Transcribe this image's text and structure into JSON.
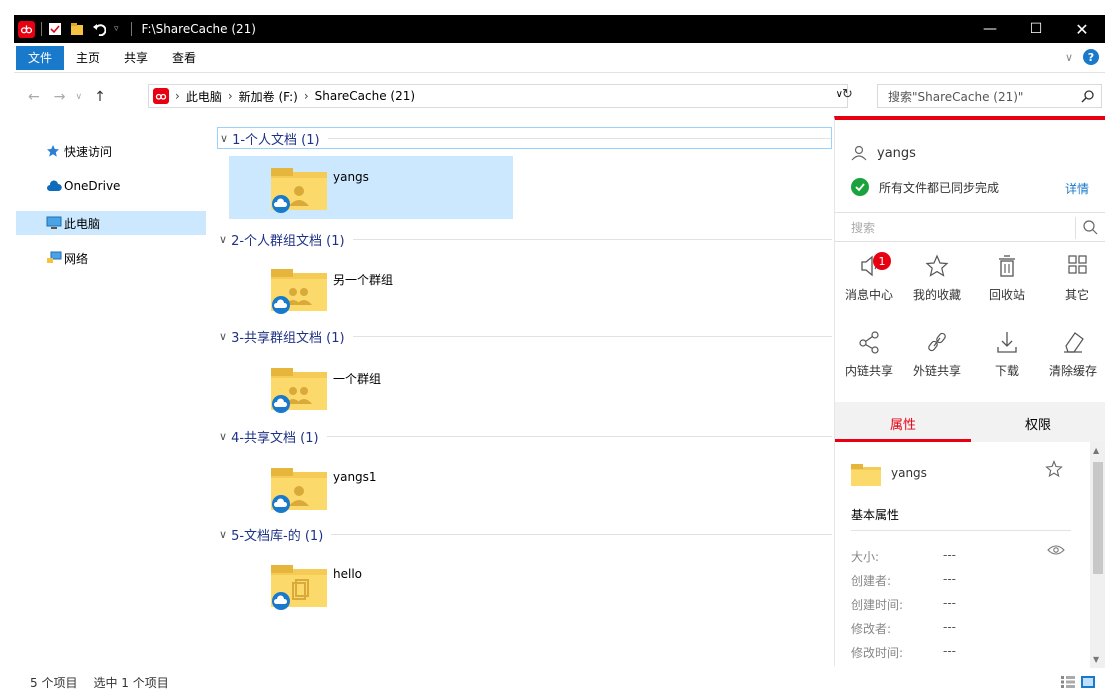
{
  "window": {
    "title": "F:\\ShareCache (21)"
  },
  "ribbon": {
    "tabs": [
      "文件",
      "主页",
      "共享",
      "查看"
    ]
  },
  "address": {
    "crumbs": [
      "此电脑",
      "新加卷 (F:)",
      "ShareCache (21)"
    ],
    "search_placeholder": "搜索\"ShareCache (21)\""
  },
  "nav": {
    "items": [
      {
        "label": "快速访问",
        "icon": "star-icon"
      },
      {
        "label": "OneDrive",
        "icon": "cloud-icon"
      },
      {
        "label": "此电脑",
        "icon": "computer-icon",
        "selected": true
      },
      {
        "label": "网络",
        "icon": "network-icon"
      }
    ]
  },
  "groups": [
    {
      "header": "1-个人文档 (1)",
      "item": "yangs",
      "icon": "person-folder-icon",
      "selected": true
    },
    {
      "header": "2-个人群组文档 (1)",
      "item": "另一个群组",
      "icon": "group-folder-icon"
    },
    {
      "header": "3-共享群组文档 (1)",
      "item": "一个群组",
      "icon": "group-folder-icon"
    },
    {
      "header": "4-共享文档 (1)",
      "item": "yangs1",
      "icon": "person-folder-icon"
    },
    {
      "header": "5-文档库-的 (1)",
      "item": "hello",
      "icon": "library-folder-icon"
    }
  ],
  "panel": {
    "user": "yangs",
    "sync_status": "所有文件都已同步完成",
    "detail_link": "详情",
    "search_placeholder": "搜索",
    "tools_row1": [
      {
        "label": "消息中心",
        "icon": "speaker-icon",
        "badge": "1"
      },
      {
        "label": "我的收藏",
        "icon": "star-icon"
      },
      {
        "label": "回收站",
        "icon": "trash-icon"
      },
      {
        "label": "其它",
        "icon": "grid-icon"
      }
    ],
    "tools_row2": [
      {
        "label": "内链共享",
        "icon": "share-icon"
      },
      {
        "label": "外链共享",
        "icon": "link-icon"
      },
      {
        "label": "下载",
        "icon": "download-icon"
      },
      {
        "label": "清除缓存",
        "icon": "eraser-icon"
      }
    ],
    "tabs": [
      "属性",
      "权限"
    ],
    "props": {
      "name": "yangs",
      "section": "基本属性",
      "rows": [
        {
          "key": "大小:",
          "value": "---"
        },
        {
          "key": "创建者:",
          "value": "---"
        },
        {
          "key": "创建时间:",
          "value": "---"
        },
        {
          "key": "修改者:",
          "value": "---"
        },
        {
          "key": "修改时间:",
          "value": "---"
        }
      ]
    }
  },
  "status": {
    "count": "5 个项目",
    "selected": "选中 1 个项目"
  },
  "colors": {
    "accent_red": "#e60012",
    "ribbon_blue": "#1979ca",
    "selection": "#cce8ff",
    "group_text": "#1e3287"
  }
}
